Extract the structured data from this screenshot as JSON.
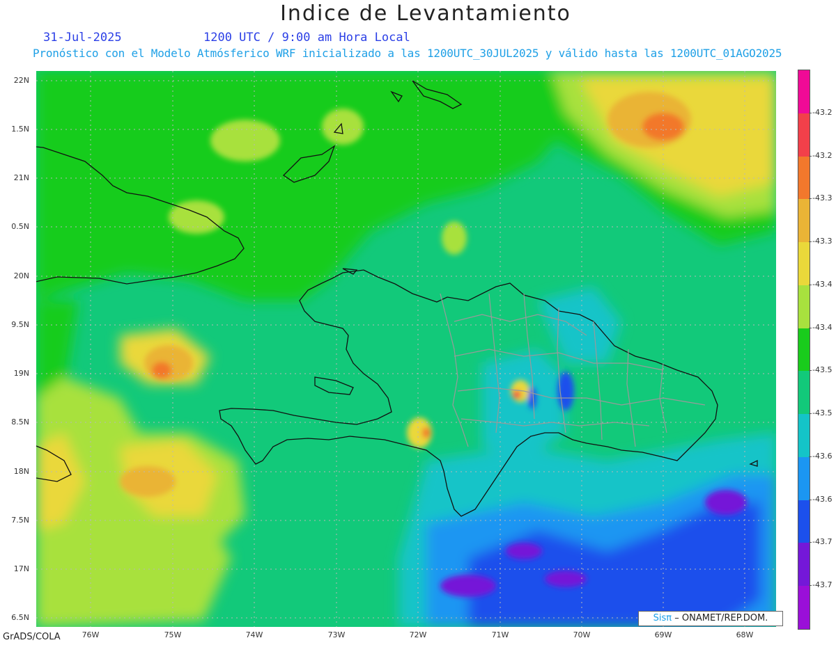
{
  "title": "Indice de Levantamiento",
  "date_label": "31-Jul-2025",
  "time_label": "1200 UTC / 9:00 am Hora Local",
  "forecast_description": "Pronóstico con el Modelo Atmósferico WRF inicializado a las 1200UTC_30JUL2025 y válido hasta las  1200UTC_01AGO2025",
  "y_ticks": [
    "22N",
    "1.5N",
    "21N",
    "0.5N",
    "20N",
    "9.5N",
    "19N",
    "8.5N",
    "18N",
    "7.5N",
    "17N",
    "6.5N"
  ],
  "x_ticks": [
    "76W",
    "75W",
    "74W",
    "73W",
    "72W",
    "71W",
    "70W",
    "69W",
    "68W"
  ],
  "colorbar": {
    "labels": [
      "-43.2",
      "-43.2",
      "-43.3",
      "-43.3",
      "-43.4",
      "-43.4",
      "-43.5",
      "-43.5",
      "-43.6",
      "-43.6",
      "-43.7",
      "-43.7"
    ],
    "colors": [
      "#f00a96",
      "#f2404a",
      "#f2782c",
      "#eab436",
      "#ead83a",
      "#a8e13e",
      "#19cc1c",
      "#12c97a",
      "#14c4c8",
      "#1b96f2",
      "#1c50ec",
      "#7418d8",
      "#9a0fd8"
    ]
  },
  "credit": {
    "brand": "Sisπ",
    "text": "– ONAMET/REP.DOM."
  },
  "footer": "GrADS/COLA"
}
